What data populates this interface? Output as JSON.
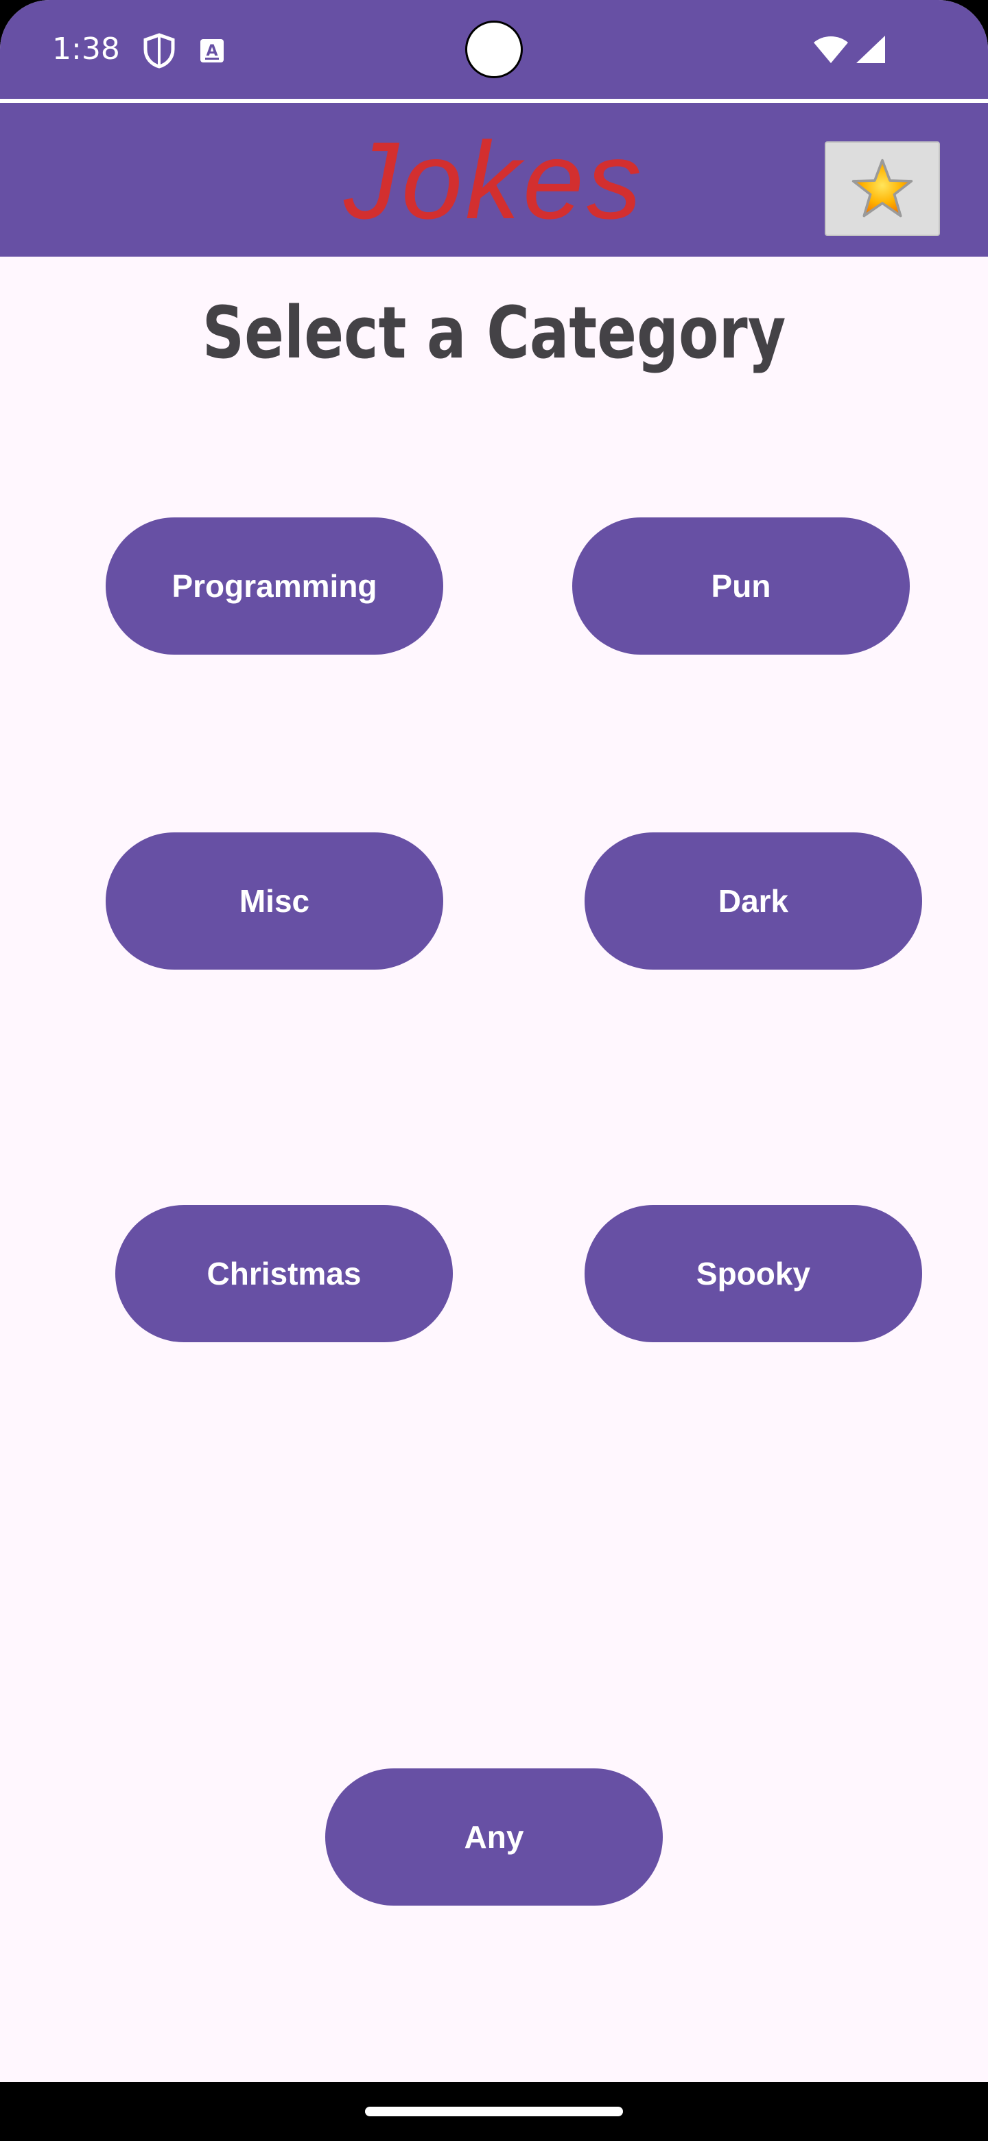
{
  "status_bar": {
    "time": "1:38",
    "icons": [
      "shield-icon",
      "accessibility-a-icon",
      "wifi-icon",
      "cell-signal-icon"
    ]
  },
  "app_bar": {
    "title": "Jokes",
    "favorites_icon": "star-icon"
  },
  "main": {
    "heading": "Select a Category",
    "categories": [
      {
        "label": "Programming"
      },
      {
        "label": "Pun"
      },
      {
        "label": "Misc"
      },
      {
        "label": "Dark"
      },
      {
        "label": "Christmas"
      },
      {
        "label": "Spooky"
      },
      {
        "label": "Any"
      }
    ]
  },
  "colors": {
    "primary": "#6750a4",
    "background": "#fff7fe",
    "title_red": "#d32f2f",
    "heading_text": "#444246",
    "button_text": "#ffffff"
  }
}
